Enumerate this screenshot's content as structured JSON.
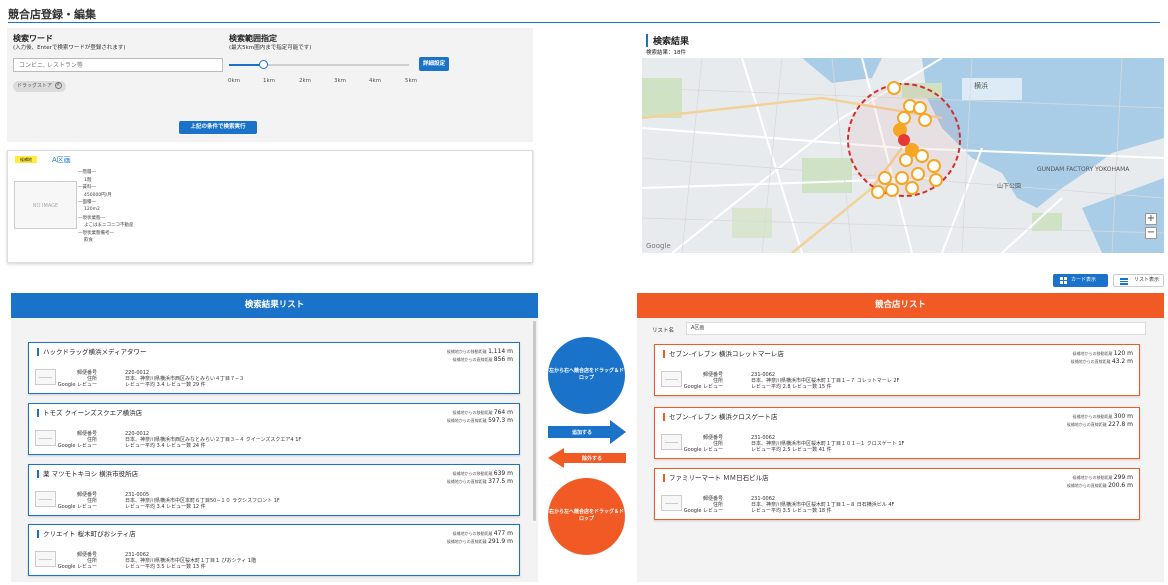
{
  "page": {
    "title": "競合店登録・編集"
  },
  "search": {
    "keyword_label": "検索ワード",
    "keyword_sub": "(入力後、Enterで検索ワードが登録されます)",
    "keyword_placeholder": "コンビニ, レストラン等",
    "tag": "ドラッグストア",
    "range_label": "検索範囲指定",
    "range_sub": "(最大5km圏内まで指定可能です)",
    "range_ticks": [
      "0km",
      "1km",
      "2km",
      "3km",
      "4km",
      "5km"
    ],
    "range_value": 0.2,
    "detail_button": "詳細設定",
    "execute_button": "上記の条件で検索実行"
  },
  "area": {
    "badge": "候補地",
    "name": "A区画",
    "noimage": "NO IMAGE",
    "info": [
      "―階層―",
      "1階",
      "―賃料―",
      "450000円/月",
      "―面積―",
      "120m2",
      "―現状業態―",
      "よこはまニコニコ不動産",
      "―現状業態備考―",
      "飲食"
    ]
  },
  "map": {
    "title": "検索結果",
    "count": "検索結果：18件",
    "labels": {
      "yokohama": "横浜",
      "gundam": "GUNDAM FACTORY YOKOHAMA",
      "yamashita": "山下公園",
      "google": "Google"
    },
    "zoom_in": "+",
    "zoom_out": "−"
  },
  "view": {
    "card_label": "カード表示",
    "list_label": "リスト表示"
  },
  "results": {
    "header": "検索結果リスト",
    "items": [
      {
        "name": "ハックドラッグ横浜メディアタワー",
        "zip": "220-0012",
        "address": "日本、神奈川県横浜市西区みなとみらい４丁目７−３",
        "review": "レビュー平均 3.4 レビュー数 29 件",
        "dist_walk": "1,114 m",
        "dist_line": "856 m"
      },
      {
        "name": "トモズ クイーンズスクエア横浜店",
        "zip": "220-0012",
        "address": "日本、神奈川県横浜市西区みなとみらい２丁目３−４ クイーンズスクエア4 1F",
        "review": "レビュー平均 3.4 レビュー数 24 件",
        "dist_walk": "764 m",
        "dist_line": "597.3 m"
      },
      {
        "name": "薬 マツモトキヨシ 横浜市役所店",
        "zip": "231-0005",
        "address": "日本、神奈川県横浜市中区本町６丁目50−１０ ラクシスフロント 1F",
        "review": "レビュー平均 3.4 レビュー数 12 件",
        "dist_walk": "639 m",
        "dist_line": "377.5 m"
      },
      {
        "name": "クリエイト 桜木町ぴおシティ店",
        "zip": "231-0062",
        "address": "日本、神奈川県横浜市中区桜木町１丁目１ ぴおシティ 1階",
        "review": "レビュー平均 3.5 レビュー数 13 件",
        "dist_walk": "477 m",
        "dist_line": "291.9 m"
      }
    ]
  },
  "card_labels": {
    "zip": "郵便番号",
    "address": "住所",
    "review": "Google レビュー",
    "dist_walk": "候補地からの移動距離",
    "dist_line": "候補地からの直線距離"
  },
  "middle": {
    "to_comp": "左から右へ競合店をドラッグ＆ドロップ",
    "to_result": "右から左へ競合店をドラッグ＆ドロップ",
    "add": "追加する",
    "remove": "除外する"
  },
  "competitors": {
    "header": "競合店リスト",
    "list_name_label": "リスト名",
    "list_name_value": "A区画",
    "items": [
      {
        "name": "セブン-イレブン 横浜コレットマーレ店",
        "zip": "231-0062",
        "address": "日本、神奈川県横浜市中区桜木町１丁目１−７ コレットマーレ 2F",
        "review": "レビュー平均 2.8 レビュー数 15 件",
        "dist_walk": "120 m",
        "dist_line": "43.2 m"
      },
      {
        "name": "セブン-イレブン 横浜クロスゲート店",
        "zip": "231-0062",
        "address": "日本、神奈川県横浜市中区桜木町１丁目１０１−１ クロスゲート 1F",
        "review": "レビュー平均 2.5 レビュー数 41 件",
        "dist_walk": "300 m",
        "dist_line": "227.8 m"
      },
      {
        "name": "ファミリーマート ＭＭ日石ビル店",
        "zip": "231-0062",
        "address": "日本、神奈川県横浜市中区桜木町１丁目１−８ 日石横浜ビル 4F",
        "review": "レビュー平均 3.5 レビュー数 18 件",
        "dist_walk": "299 m",
        "dist_line": "200.6 m"
      }
    ]
  },
  "colors": {
    "blue": "#1a73c9",
    "orange": "#f15a24",
    "panel": "#f3f3f3"
  }
}
